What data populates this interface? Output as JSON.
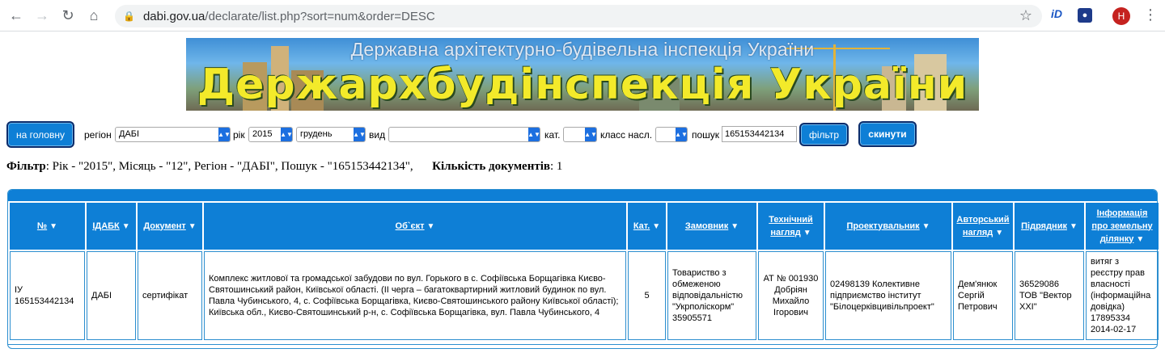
{
  "browser": {
    "url_host": "dabi.gov.ua",
    "url_path": "/declarate/list.php?sort=num&order=DESC",
    "ext_id_label": "iD",
    "avatar_letter": "H"
  },
  "banner": {
    "subtitle": "Державна архітектурно-будівельна інспекція України",
    "title": "Держархбудінспекція України"
  },
  "filters": {
    "home_button": "на головну",
    "region_label": "регіон",
    "region_value": "ДАБІ",
    "year_label": "рік",
    "year_value": "2015",
    "month_value": "грудень",
    "type_label": "вид",
    "type_value": "",
    "cat_label": "кат.",
    "cat_value": "",
    "class_label": "класс насл.",
    "class_value": "",
    "search_label": "пошук",
    "search_value": "165153442134",
    "filter_button": "фільтр",
    "reset_button": "скинути"
  },
  "summary": {
    "filter_label": "Фільтр",
    "filter_text": ": Рік - \"2015\", Місяць - \"12\", Регіон - \"ДАБІ\", Пошук - \"165153442134\",",
    "count_label": "Кількість документів",
    "count_value": ": 1"
  },
  "table": {
    "columns": [
      "№",
      "ІДАБК",
      "Документ",
      "Об`єкт",
      "Кат.",
      "Замовник",
      "Технічний нагляд",
      "Проектувальник",
      "Авторський нагляд",
      "Підрядник",
      "Інформація про земельну ділянку"
    ],
    "rows": [
      {
        "num": "ІУ 165153442134",
        "idabk": "ДАБІ",
        "doc": "сертифікат",
        "object": "Комплекс житлової та громадської забудови по вул. Горького в с. Софіївська Борщагівка Києво-Святошинський район, Київської області. (ІІ черга – багатоквартирний житловий будинок по вул. Павла Чубинського, 4, с. Софіївська Борщагівка, Києво-Святошинського району Київської області); Київська обл., Києво-Святошинський р-н, с. Софіївська Борщагівка, вул. Павла Чубинського, 4",
        "cat": "5",
        "customer": "Товариство з обмеженою відповідальністю \"Укрполіскорм\" 35905571",
        "tech": "АТ № 001930 Добріян Михайло Ігорович",
        "designer": "02498139 Колективне підприємство інститут \"Білоцерківцивільпроект\"",
        "author": "Дем'янюк Сергій Петрович",
        "contractor": "36529086 ТОВ \"Вектор ХХІ\"",
        "land": "витяг з реєстру прав власності (інформаційна довідка) 17895334 2014-02-17"
      }
    ]
  }
}
